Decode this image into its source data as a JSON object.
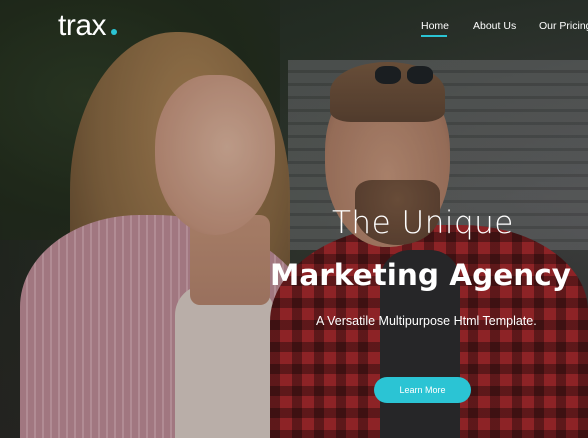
{
  "brand": {
    "name": "trax",
    "accent_color": "#2bc4d4"
  },
  "nav": {
    "items": [
      {
        "label": "Home",
        "active": true
      },
      {
        "label": "About Us",
        "active": false
      },
      {
        "label": "Our Pricing",
        "active": false
      }
    ]
  },
  "hero": {
    "title_line1": "The Unique",
    "title_line2": "Marketing Agency",
    "subtitle": "A Versatile Multipurpose Html Template.",
    "cta_label": "Learn More"
  }
}
